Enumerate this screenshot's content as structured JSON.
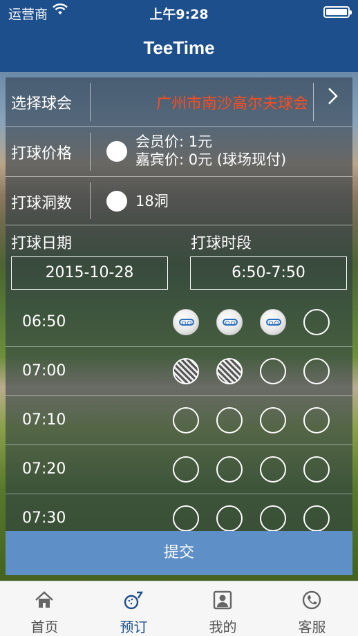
{
  "status_bar": {
    "carrier": "运营商",
    "time": "上午9:28"
  },
  "nav": {
    "title": "TeeTime"
  },
  "form": {
    "club_label": "选择球会",
    "club_value": "广州市南沙高尔夫球会",
    "price_label": "打球价格",
    "member_price": "会员价: 1元",
    "guest_price": "嘉宾价: 0元 (球场现付)",
    "holes_label": "打球洞数",
    "holes_value": "18洞",
    "date_label": "打球日期",
    "time_label": "打球时段",
    "date_value": "2015-10-28",
    "time_value": "6:50-7:50"
  },
  "slots": [
    {
      "time": "06:50",
      "states": [
        "booked",
        "booked",
        "booked",
        "empty"
      ]
    },
    {
      "time": "07:00",
      "states": [
        "taken",
        "taken",
        "empty",
        "empty"
      ]
    },
    {
      "time": "07:10",
      "states": [
        "empty",
        "empty",
        "empty",
        "empty"
      ]
    },
    {
      "time": "07:20",
      "states": [
        "empty",
        "empty",
        "empty",
        "empty"
      ]
    },
    {
      "time": "07:30",
      "states": [
        "empty",
        "empty",
        "empty",
        "empty"
      ]
    }
  ],
  "submit_label": "提交",
  "tabs": [
    {
      "label": "首页",
      "icon": "home-icon"
    },
    {
      "label": "预订",
      "icon": "golf-booking-icon",
      "active": true
    },
    {
      "label": "我的",
      "icon": "profile-icon"
    },
    {
      "label": "客服",
      "icon": "phone-icon"
    }
  ],
  "colors": {
    "nav_bg": "#1d4f8c",
    "club_name": "#ff4b1e",
    "submit_bg": "#5e8fc6"
  }
}
